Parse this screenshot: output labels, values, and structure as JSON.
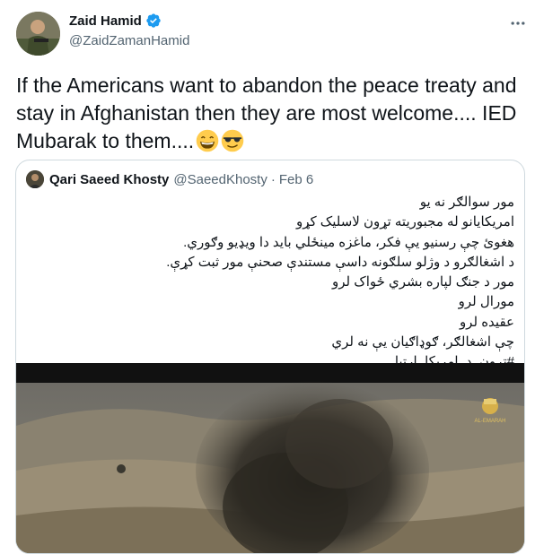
{
  "tweet": {
    "author_name": "Zaid Hamid",
    "author_handle": "@ZaidZamanHamid",
    "text": "If the Americans want to abandon the peace treaty and stay in Afghanistan then they are most welcome.... IED Mubarak to them....",
    "emojis": [
      "grinning-face-with-smiling-eyes",
      "smiling-face-with-sunglasses"
    ]
  },
  "quoted": {
    "author_name": "Qari Saeed Khosty",
    "author_handle": "@SaeedKhosty",
    "separator": "·",
    "date": "Feb 6",
    "lines": [
      "مور سوالګر نه يو",
      "امريکايانو له مجبوريته تړون لاسليک کړو",
      "هغوئ چې رسنيو يې فکر، ماغزه مينځلي بايد دا ويډيو وګوري.",
      "د اشغالګرو د وژلو سلګونه داسې مستندې صحنې مور ثبت کړې.",
      "مور د جنګ لپاره بشري ځواک لرو",
      "مورال لرو",
      "عقيده لرو",
      "چې اشغالګر، ګوډاګيان يې نه لري",
      "#تړون_د_امريکا_اړتيا"
    ],
    "media_watermark": "AL-EMARAH"
  },
  "colors": {
    "text": "#0f1419",
    "secondary": "#536471",
    "verified": "#1d9bf0",
    "border": "#cfd9de"
  }
}
